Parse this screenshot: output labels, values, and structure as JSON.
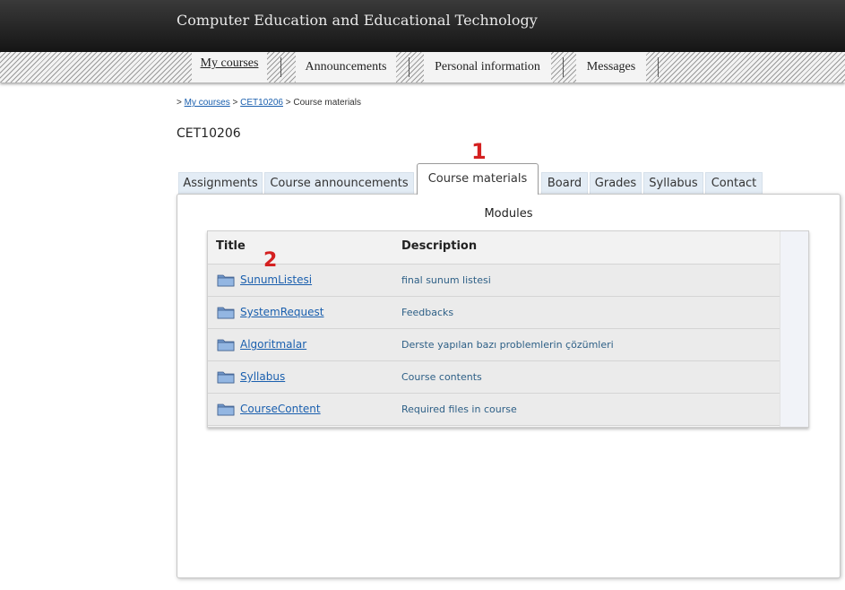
{
  "header": {
    "title": "Computer Education and Educational Technology"
  },
  "nav": {
    "items": [
      "My courses",
      "Announcements",
      "Personal information",
      "Messages"
    ]
  },
  "breadcrumb": {
    "prefix": ">",
    "my_courses": "My courses",
    "sep1": ">",
    "course": "CET10206",
    "sep2": ">",
    "current": "Course materials"
  },
  "course_code": "CET10206",
  "tabs": [
    "Assignments",
    "Course announcements",
    "Course materials",
    "Board",
    "Grades",
    "Syllabus",
    "Contact"
  ],
  "active_tab": "Course materials",
  "panel": {
    "title": "Modules"
  },
  "table": {
    "headers": {
      "title": "Title",
      "description": "Description"
    },
    "rows": [
      {
        "title": "SunumListesi",
        "description": "final sunum listesi"
      },
      {
        "title": "SystemRequest",
        "description": "Feedbacks"
      },
      {
        "title": "Algoritmalar",
        "description": "Derste yapılan bazı problemlerin çözümleri"
      },
      {
        "title": "Syllabus",
        "description": "Course contents"
      },
      {
        "title": "CourseContent",
        "description": "Required files in course"
      }
    ]
  },
  "annotations": {
    "one": "1",
    "two": "2"
  },
  "colors": {
    "link": "#1a5fae",
    "annotation": "#d42020",
    "tab_bg": "#e3ecf5"
  }
}
